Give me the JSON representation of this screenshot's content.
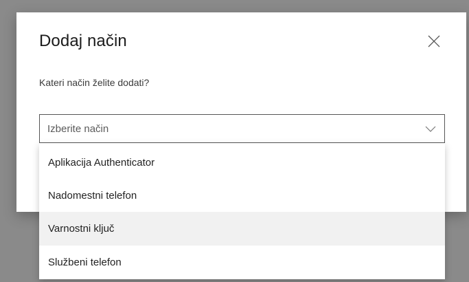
{
  "dialog": {
    "title": "Dodaj način",
    "prompt": "Kateri način želite dodati?",
    "close_icon": "close-icon"
  },
  "select": {
    "placeholder": "Izberite način",
    "chevron_icon": "chevron-down-icon",
    "options": [
      {
        "label": "Aplikacija Authenticator"
      },
      {
        "label": "Nadomestni telefon"
      },
      {
        "label": "Varnostni ključ",
        "highlighted": true
      },
      {
        "label": "Službeni telefon"
      }
    ]
  },
  "colors": {
    "backdrop": "#8a8a8a",
    "dialog_bg": "#ffffff",
    "option_hover_bg": "#f1f1f1",
    "select_border": "#555555"
  }
}
